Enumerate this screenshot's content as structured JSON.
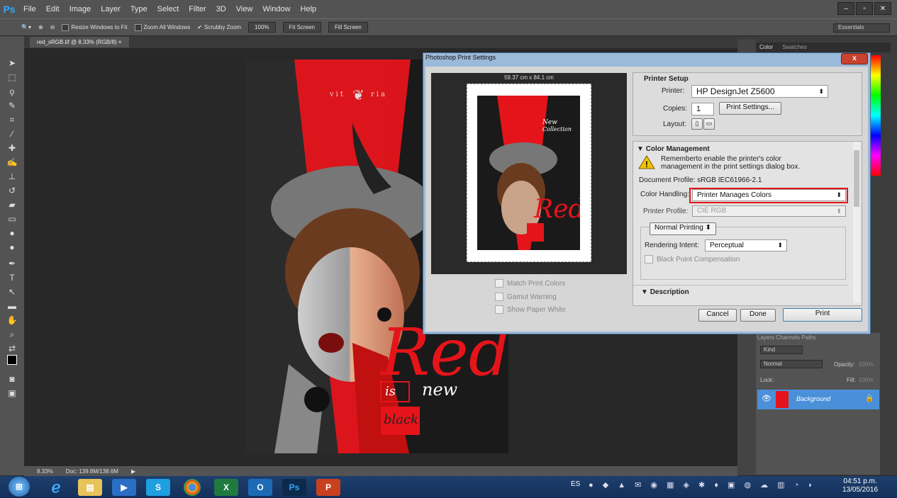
{
  "app": {
    "logo": "Ps",
    "menus": [
      "File",
      "Edit",
      "Image",
      "Layer",
      "Type",
      "Select",
      "Filter",
      "3D",
      "View",
      "Window",
      "Help"
    ]
  },
  "window_controls": [
    "–",
    "▫",
    "✕"
  ],
  "options_bar": {
    "resize_windows": "Resize Windows to Fit",
    "zoom_all": "Zoom All Windows",
    "scrubby_zoom": "Scrubby Zoom",
    "zoom_pct": "100%",
    "fit_screen": "Fit Screen",
    "fill_screen": "Fill Screen",
    "workspace": "Essentials"
  },
  "document": {
    "tab": "red_sRGB.tif @ 8.33% (RGB/8)",
    "tab_close": "×"
  },
  "artwork": {
    "brand_left": "vit",
    "brand_right": "ria",
    "word_red": "Red",
    "word_is": "is",
    "word_new": "new",
    "word_black": "black",
    "thumb_new": "New",
    "thumb_collection": "Collection"
  },
  "status": {
    "zoom": "8.33%",
    "doc": "Doc: 139.8M/138.6M"
  },
  "panels": {
    "color_tab": "Color",
    "swatches_tab": "Swatches",
    "layers_tab": "Layers",
    "channels_tab": "Channels",
    "paths_tab": "Paths",
    "kind": "Kind",
    "blend": "Normal",
    "opacity": "Opacity:",
    "opacity_val": "100%",
    "lock": "Lock:",
    "fill": "Fill:",
    "fill_val": "100%",
    "layer_name": "Background"
  },
  "dialog": {
    "title": "Photoshop Print Settings",
    "close": "x",
    "paper_size": "59.37 cm x 84.1 cm",
    "match_print_colors": "Match Print Colors",
    "gamut_warning": "Gamut Warning",
    "show_paper_white": "Show Paper White",
    "printer_setup": {
      "heading": "Printer Setup",
      "printer_label": "Printer:",
      "printer_value": "HP DesignJet Z5600",
      "copies_label": "Copies:",
      "copies_value": "1",
      "print_settings": "Print Settings...",
      "layout_label": "Layout:"
    },
    "color_management": {
      "heading": "Color Management",
      "warning": "Rememberto enable the printer's color management in the print settings dialog box.",
      "doc_profile": "Document Profile: sRGB IEC61966-2.1",
      "handling_label": "Color Handling:",
      "handling_value": "Printer Manages Colors",
      "printer_profile_label": "Printer Profile:",
      "printer_profile_value": "CIE RGB",
      "normal_printing": "Normal Printing",
      "rendering_label": "Rendering Intent:",
      "rendering_value": "Perceptual",
      "bpc": "Black Point Compensation",
      "description": "Description"
    },
    "buttons": {
      "cancel": "Cancel",
      "done": "Done",
      "print": "Print"
    }
  },
  "taskbar": {
    "lang": "ES",
    "time": "04:51 p.m.",
    "date": "13/05/2016"
  },
  "colors": {
    "accent_red": "#e8191a",
    "highlight": "#e5141a"
  }
}
